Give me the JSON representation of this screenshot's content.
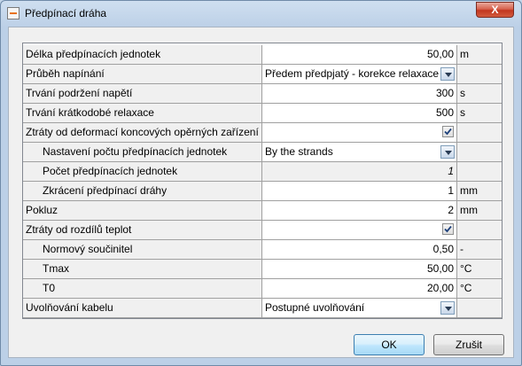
{
  "window": {
    "title": "Předpínací dráha",
    "close_label": "X"
  },
  "properties": [
    {
      "key": "delka",
      "label": "Délka předpínacích jednotek",
      "indent": 0,
      "value": "50,00",
      "unit": "m",
      "kind": "number"
    },
    {
      "key": "prubeh",
      "label": "Průběh napínání",
      "indent": 0,
      "value": "Předem předpjatý - korekce relaxace",
      "unit": "",
      "kind": "dropdown"
    },
    {
      "key": "trvani_podrzeni",
      "label": "Trvání podržení napětí",
      "indent": 0,
      "value": "300",
      "unit": "s",
      "kind": "number"
    },
    {
      "key": "trvani_relaxace",
      "label": "Trvání krátkodobé relaxace",
      "indent": 0,
      "value": "500",
      "unit": "s",
      "kind": "number"
    },
    {
      "key": "ztraty_deformaci",
      "label": "Ztráty od deformací koncových opěrných zařízení",
      "indent": 0,
      "value": "",
      "unit": "",
      "kind": "checkbox",
      "checked": true
    },
    {
      "key": "nastaveni_poctu",
      "label": "Nastavení počtu předpínacích jednotek",
      "indent": 1,
      "value": "By the strands",
      "unit": "",
      "kind": "dropdown"
    },
    {
      "key": "pocet",
      "label": "Počet předpínacích jednotek",
      "indent": 1,
      "value": "1",
      "unit": "",
      "kind": "readonly"
    },
    {
      "key": "zkraceni",
      "label": "Zkrácení předpínací dráhy",
      "indent": 1,
      "value": "1",
      "unit": "mm",
      "kind": "number"
    },
    {
      "key": "pokluz",
      "label": "Pokluz",
      "indent": 0,
      "value": "2",
      "unit": "mm",
      "kind": "number"
    },
    {
      "key": "ztraty_teplot",
      "label": "Ztráty od rozdílů teplot",
      "indent": 0,
      "value": "",
      "unit": "",
      "kind": "checkbox",
      "checked": true
    },
    {
      "key": "normovy",
      "label": "Normový součinitel",
      "indent": 1,
      "value": "0,50",
      "unit": "-",
      "kind": "number"
    },
    {
      "key": "tmax",
      "label": "Tmax",
      "indent": 1,
      "value": "50,00",
      "unit": "°C",
      "kind": "number"
    },
    {
      "key": "t0",
      "label": "T0",
      "indent": 1,
      "value": "20,00",
      "unit": "°C",
      "kind": "number"
    },
    {
      "key": "uvolnovani",
      "label": "Uvolňování kabelu",
      "indent": 0,
      "value": "Postupné uvolňování",
      "unit": "",
      "kind": "dropdown"
    }
  ],
  "buttons": {
    "ok": "OK",
    "cancel": "Zrušit"
  }
}
